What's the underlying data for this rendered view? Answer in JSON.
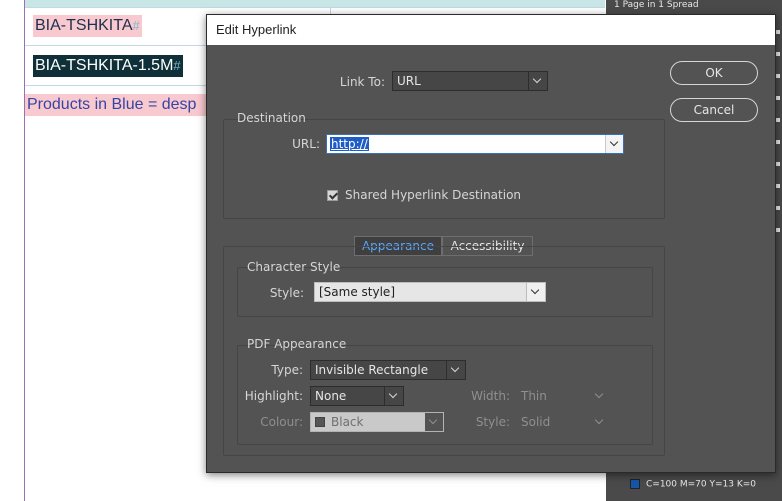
{
  "document": {
    "cell1": "BIA-TSHKITA",
    "cell2": "BIA-TSHKITA-1.5M",
    "cell3": "Products in Blue = desp",
    "end_mark": "#"
  },
  "panel": {
    "title": "1 Page in 1 Spread",
    "swatch_label": "C=100 M=70 Y=13 K=0",
    "swatch_color": "#1556a8"
  },
  "dialog": {
    "title": "Edit Hyperlink",
    "link_to_label": "Link To:",
    "link_to_value": "URL",
    "ok_label": "OK",
    "cancel_label": "Cancel",
    "destination": {
      "group_label": "Destination",
      "url_label": "URL:",
      "url_value": "http://",
      "shared_label": "Shared Hyperlink Destination",
      "shared_checked": true
    },
    "tabs": {
      "appearance": "Appearance",
      "accessibility": "Accessibility",
      "active": "Appearance"
    },
    "character_style": {
      "group_label": "Character Style",
      "style_label": "Style:",
      "style_value": "[Same style]"
    },
    "pdf_appearance": {
      "group_label": "PDF Appearance",
      "type_label": "Type:",
      "type_value": "Invisible Rectangle",
      "highlight_label": "Highlight:",
      "highlight_value": "None",
      "width_label": "Width:",
      "width_value": "Thin",
      "colour_label": "Colour:",
      "colour_value": "Black",
      "style_label": "Style:",
      "style_value": "Solid"
    }
  },
  "colors": {
    "dialog_bg": "#535353",
    "accent": "#5aa7ff",
    "selection": "#1e5cc8"
  }
}
